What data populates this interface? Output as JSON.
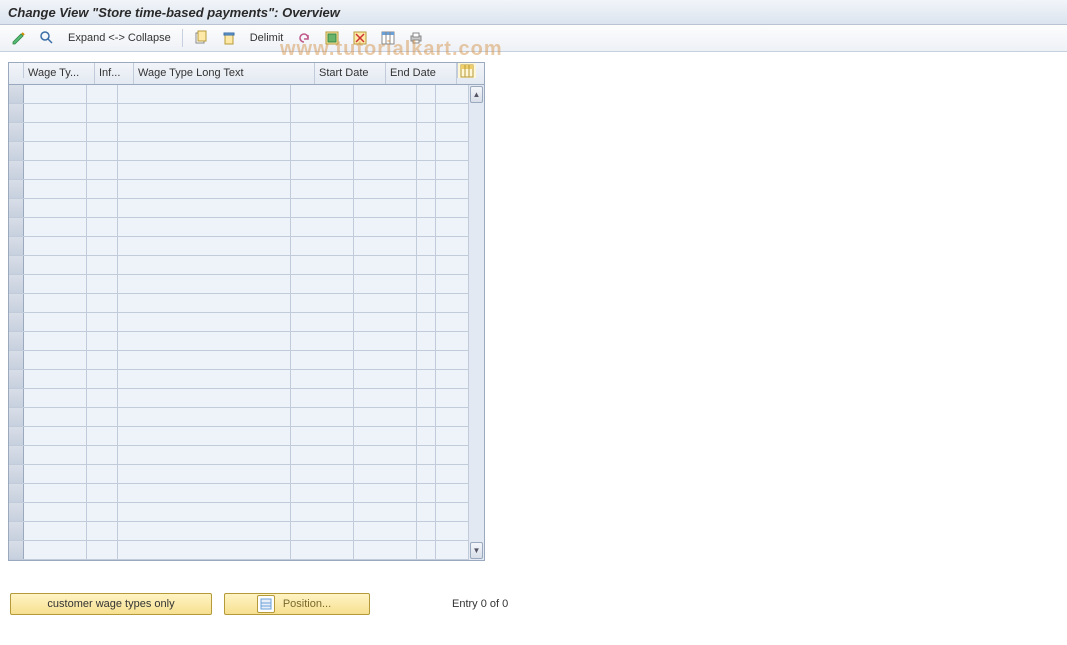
{
  "title": "Change View \"Store time-based payments\": Overview",
  "toolbar": {
    "expand_collapse_label": "Expand <-> Collapse",
    "delimit_label": "Delimit"
  },
  "table": {
    "columns": {
      "wage_type": "Wage Ty...",
      "infotype": "Inf...",
      "wage_long": "Wage Type Long Text",
      "start_date": "Start Date",
      "end_date": "End Date"
    },
    "row_count": 25
  },
  "footer": {
    "customer_btn": "customer wage types only",
    "position_btn": "Position...",
    "entry_status": "Entry 0 of 0"
  },
  "watermark": "www.tutorialkart.com"
}
